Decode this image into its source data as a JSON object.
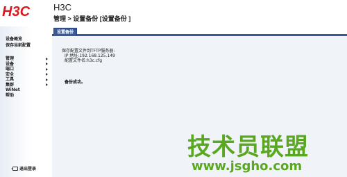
{
  "logo": "H3C",
  "header": {
    "title": "H3C",
    "breadcrumb": "管理 > 设置备份 [设置备份 ]"
  },
  "sidebar": {
    "top_items": [
      {
        "label": "设备概览"
      },
      {
        "label": "保存当前配置"
      }
    ],
    "menu": [
      {
        "label": "管理",
        "has_submenu": true
      },
      {
        "label": "设备",
        "has_submenu": true
      },
      {
        "label": "端口",
        "has_submenu": true
      },
      {
        "label": "安全",
        "has_submenu": true
      },
      {
        "label": "工具",
        "has_submenu": true
      },
      {
        "label": "集群",
        "has_submenu": true
      },
      {
        "label": "WiNet",
        "has_submenu": false
      },
      {
        "label": "帮助",
        "has_submenu": false
      }
    ],
    "logout_label": "退出登录"
  },
  "tabs": [
    {
      "label": "设置备份",
      "active": true
    }
  ],
  "content": {
    "line1": "保存配置文件到TFTP服务器:",
    "line2": "IP 地址:192.168.125.149",
    "line3": "配置文件名:h3c.cfg",
    "status": "备份成功。"
  },
  "watermark": {
    "text": "技术员联盟",
    "url": "www.jsgho.com"
  },
  "colors": {
    "logo_red": "#d8191f",
    "tab_blue": "#3a5998",
    "content_bg": "#f0f3f8",
    "watermark_green": "#5aa820"
  }
}
